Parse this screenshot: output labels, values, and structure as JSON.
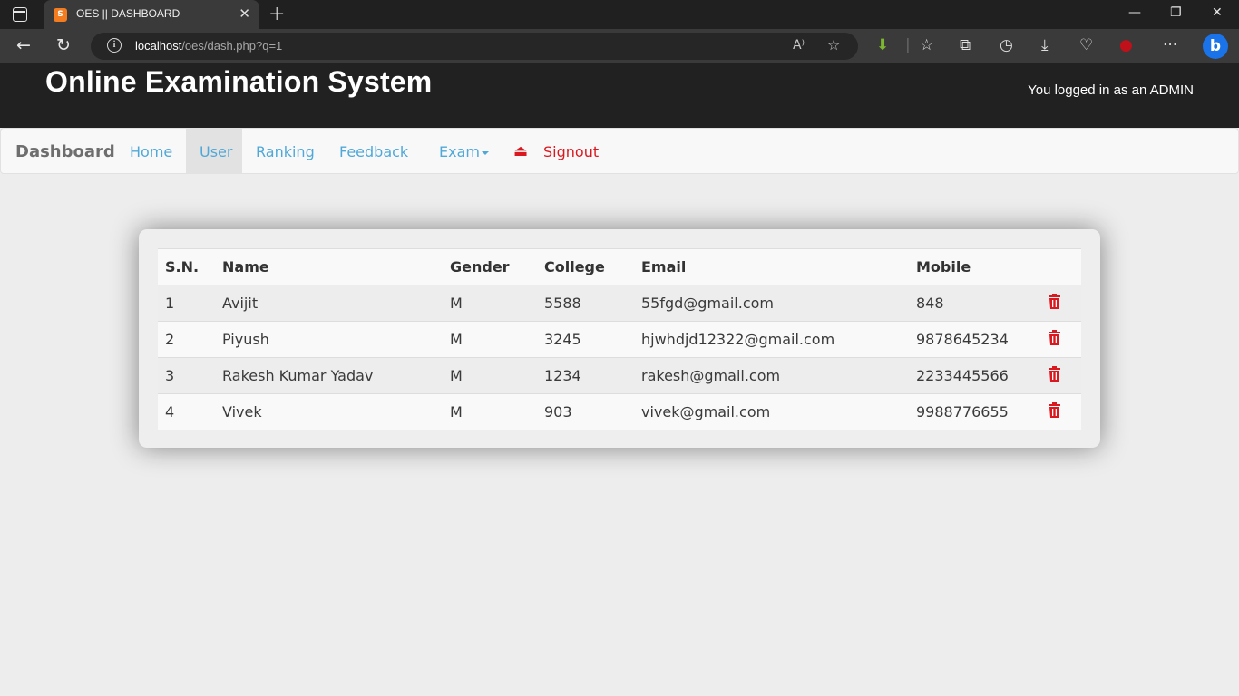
{
  "browser": {
    "tab_title": "OES || DASHBOARD",
    "favicon_glyph": "S",
    "url_host": "localhost",
    "url_path": "/oes/dash.php?q=1"
  },
  "header": {
    "site_title": "Online Examination System",
    "logged_in_text": "You logged in as an ADMIN"
  },
  "navbar": {
    "brand": "Dashboard",
    "links": [
      "Home",
      "User",
      "Ranking",
      "Feedback",
      "Exam"
    ],
    "active": "User",
    "signout_label": "Signout",
    "link_color": "#4fa8d8",
    "signout_color": "#d9191f"
  },
  "table": {
    "headers": [
      "S.N.",
      "Name",
      "Gender",
      "College",
      "Email",
      "Mobile"
    ],
    "rows": [
      [
        "1",
        "Avijit",
        "M",
        "5588",
        "55fgd@gmail.com",
        "848"
      ],
      [
        "2",
        "Piyush",
        "M",
        "3245",
        "hjwhdjd12322@gmail.com",
        "9878645234"
      ],
      [
        "3",
        "Rakesh Kumar Yadav",
        "M",
        "1234",
        "rakesh@gmail.com",
        "2233445566"
      ],
      [
        "4",
        "Vivek",
        "M",
        "903",
        "vivek@gmail.com",
        "9988776655"
      ]
    ],
    "delete_icon": "trash-icon"
  }
}
